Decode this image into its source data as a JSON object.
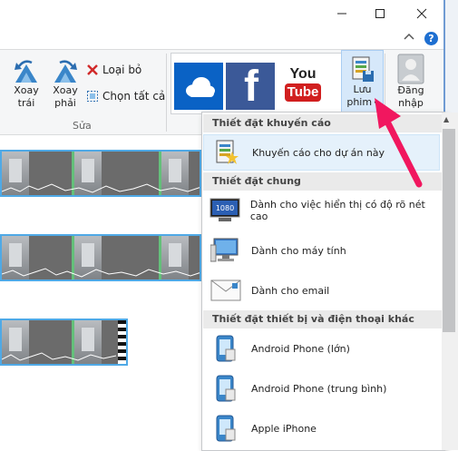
{
  "colors": {
    "accent_pink": "#f1175f",
    "selection_blue": "#4fa9e6",
    "ribbon_bg": "#f5f6f7"
  },
  "window": {
    "minimize_icon": "minimize-icon",
    "maximize_icon": "maximize-icon",
    "close_icon": "close-icon"
  },
  "ribbon": {
    "rotate_left": {
      "line1": "Xoay",
      "line2": "trái"
    },
    "rotate_right": {
      "line1": "Xoay",
      "line2": "phải"
    },
    "remove": "Loại bỏ",
    "select_all": "Chọn tất cả",
    "edit_group": "Sửa",
    "share_tiles": [
      {
        "name": "OneDrive",
        "icon": "onedrive-icon"
      },
      {
        "name": "Facebook",
        "icon": "facebook-icon",
        "glyph": "f"
      },
      {
        "name": "YouTube",
        "icon": "youtube-icon",
        "glyph_you": "You",
        "glyph_tube": "Tube"
      }
    ],
    "save_movie": {
      "line1": "Lưu",
      "line2": "phim"
    },
    "sign_in": {
      "line1": "Đăng",
      "line2": "nhập"
    }
  },
  "menu": {
    "sections": [
      {
        "title": "Thiết đặt khuyến cáo"
      },
      {
        "title": "Thiết đặt chung"
      },
      {
        "title": "Thiết đặt thiết bị và điện thoại khác"
      }
    ],
    "items": [
      {
        "label": "Khuyến cáo cho dự án này",
        "icon": "recommended-settings-icon"
      },
      {
        "label": "Dành cho việc hiển thị có độ rõ nét cao",
        "icon": "hd-display-icon",
        "badge": "1080"
      },
      {
        "label": "Dành cho máy tính",
        "icon": "computer-icon"
      },
      {
        "label": "Dành cho email",
        "icon": "email-icon"
      },
      {
        "label": "Android Phone (lớn)",
        "icon": "phone-icon"
      },
      {
        "label": "Android Phone (trung bình)",
        "icon": "phone-icon"
      },
      {
        "label": "Apple iPhone",
        "icon": "phone-icon"
      }
    ]
  }
}
